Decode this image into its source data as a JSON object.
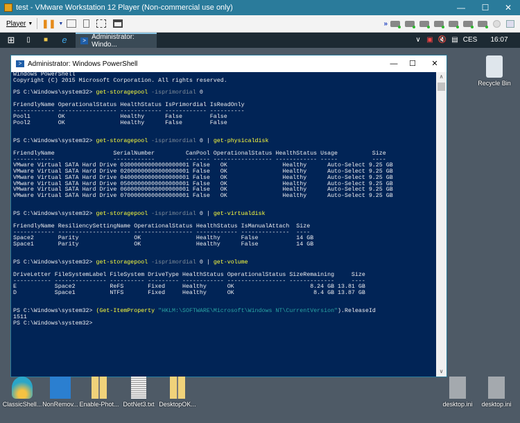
{
  "vm": {
    "title": "test - VMware Workstation 12 Player (Non-commercial use only)",
    "player_menu": "Player",
    "colors": {
      "titlebar": "#2a7b9b",
      "console_bg": "#012456"
    }
  },
  "taskbar": {
    "active_task": "Administrator: Windo...",
    "lang": "CES",
    "time": "16:07"
  },
  "powershell": {
    "title": "Administrator: Windows PowerShell"
  },
  "console": {
    "lines": [
      [
        {
          "t": "Windows PowerShell"
        }
      ],
      [
        {
          "t": "Copyright (C) 2015 Microsoft Corporation. All rights reserved."
        }
      ],
      [],
      [
        {
          "t": "PS C:\\Windows\\system32> "
        },
        {
          "t": "get-storagepool",
          "c": "cmd"
        },
        {
          "t": " -isprimordial",
          "c": "par"
        },
        {
          "t": " 0"
        }
      ],
      [],
      [
        {
          "t": "FriendlyName OperationalStatus HealthStatus IsPrimordial IsReadOnly"
        }
      ],
      [
        {
          "t": "------------ ----------------- ------------ ------------ ----------"
        }
      ],
      [
        {
          "t": "Pool1        OK                Healthy      False        False"
        }
      ],
      [
        {
          "t": "Pool2        OK                Healthy      False        False"
        }
      ],
      [],
      [],
      [
        {
          "t": "PS C:\\Windows\\system32> "
        },
        {
          "t": "get-storagepool",
          "c": "cmd"
        },
        {
          "t": " -isprimordial",
          "c": "par"
        },
        {
          "t": " 0 | "
        },
        {
          "t": "get-physicaldisk",
          "c": "cmd"
        }
      ],
      [],
      [
        {
          "t": "FriendlyName                 SerialNumber         CanPool OperationalStatus HealthStatus Usage          Size"
        }
      ],
      [
        {
          "t": "------------                 ------------         ------- ----------------- ------------ -----          ----"
        }
      ],
      [
        {
          "t": "VMware Virtual SATA Hard Drive 03000000000000000001 False   OK                Healthy      Auto-Select 9.25 GB"
        }
      ],
      [
        {
          "t": "VMware Virtual SATA Hard Drive 02000000000000000001 False   OK                Healthy      Auto-Select 9.25 GB"
        }
      ],
      [
        {
          "t": "VMware Virtual SATA Hard Drive 04000000000000000001 False   OK                Healthy      Auto-Select 9.25 GB"
        }
      ],
      [
        {
          "t": "VMware Virtual SATA Hard Drive 05000000000000000001 False   OK                Healthy      Auto-Select 9.25 GB"
        }
      ],
      [
        {
          "t": "VMware Virtual SATA Hard Drive 06000000000000000001 False   OK                Healthy      Auto-Select 9.25 GB"
        }
      ],
      [
        {
          "t": "VMware Virtual SATA Hard Drive 07000000000000000001 False   OK                Healthy      Auto-Select 9.25 GB"
        }
      ],
      [],
      [],
      [
        {
          "t": "PS C:\\Windows\\system32> "
        },
        {
          "t": "get-storagepool",
          "c": "cmd"
        },
        {
          "t": " -isprimordial",
          "c": "par"
        },
        {
          "t": " 0 | "
        },
        {
          "t": "get-virtualdisk",
          "c": "cmd"
        }
      ],
      [],
      [
        {
          "t": "FriendlyName ResiliencySettingName OperationalStatus HealthStatus IsManualAttach  Size"
        }
      ],
      [
        {
          "t": "------------ --------------------- ----------------- ------------ --------------  ----"
        }
      ],
      [
        {
          "t": "Space2       Parity                OK                Healthy      False           14 GB"
        }
      ],
      [
        {
          "t": "Space1       Parity                OK                Healthy      False           14 GB"
        }
      ],
      [],
      [],
      [
        {
          "t": "PS C:\\Windows\\system32> "
        },
        {
          "t": "get-storagepool",
          "c": "cmd"
        },
        {
          "t": " -isprimordial",
          "c": "par"
        },
        {
          "t": " 0 | "
        },
        {
          "t": "get-volume",
          "c": "cmd"
        }
      ],
      [],
      [
        {
          "t": "DriveLetter FileSystemLabel FileSystem DriveType HealthStatus OperationalStatus SizeRemaining     Size"
        }
      ],
      [
        {
          "t": "----------- --------------- ---------- --------- ------------ ----------------- -------------     ----"
        }
      ],
      [
        {
          "t": "E           Space2          ReFS       Fixed     Healthy      OK                      8.24 GB 13.81 GB"
        }
      ],
      [
        {
          "t": "D           Space1          NTFS       Fixed     Healthy      OK                       8.4 GB 13.87 GB"
        }
      ],
      [],
      [],
      [
        {
          "t": "PS C:\\Windows\\system32> "
        },
        {
          "t": "(Get-ItemProperty",
          "c": "cmd"
        },
        {
          "t": " \"HKLM:\\SOFTWARE\\Microsoft\\Windows NT\\CurrentVersion\"",
          "c": "str"
        },
        {
          "t": ").ReleaseId"
        }
      ],
      [
        {
          "t": "1511"
        }
      ],
      [
        {
          "t": "PS C:\\Windows\\system32>"
        }
      ]
    ]
  },
  "desktop": {
    "recycle_bin": "Recycle Bin",
    "icons": [
      {
        "label": "ClassicShell...",
        "icon": "classic-shell-icon"
      },
      {
        "label": "NonRemov...",
        "icon": "registry-icon"
      },
      {
        "label": "Enable-Phot...",
        "icon": "zip-folder-icon"
      },
      {
        "label": "DotNet3.txt",
        "icon": "text-file-icon"
      },
      {
        "label": "DesktopOK...",
        "icon": "zip-folder-icon"
      }
    ],
    "right_icons": [
      {
        "label": "desktop.ini",
        "icon": "settings-file-icon"
      },
      {
        "label": "desktop.ini",
        "icon": "settings-file-icon"
      }
    ]
  }
}
